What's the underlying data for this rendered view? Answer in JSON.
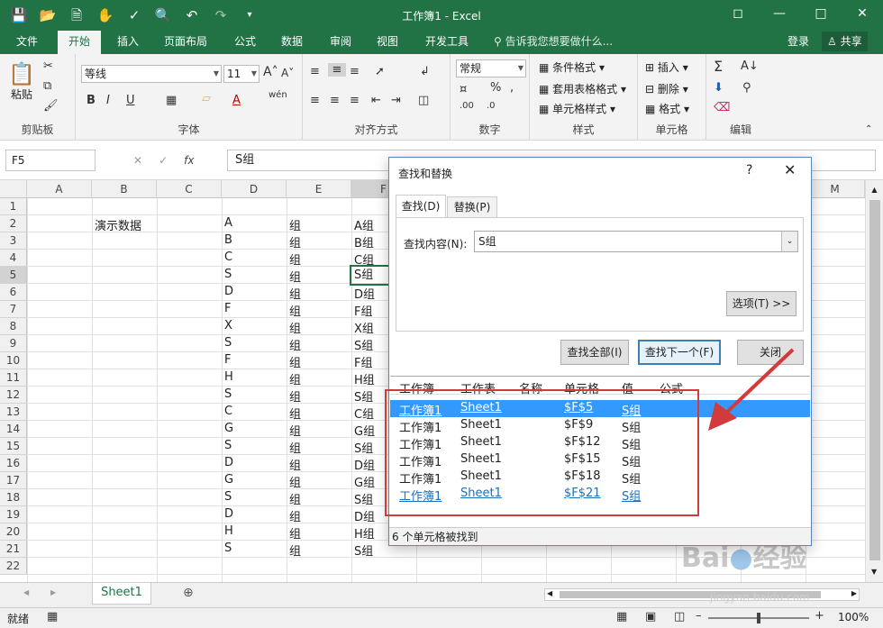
{
  "window": {
    "title": "工作簿1 - Excel"
  },
  "ribbon_tabs": [
    {
      "label": "文件"
    },
    {
      "label": "开始"
    },
    {
      "label": "插入"
    },
    {
      "label": "页面布局"
    },
    {
      "label": "公式"
    },
    {
      "label": "数据"
    },
    {
      "label": "审阅"
    },
    {
      "label": "视图"
    },
    {
      "label": "开发工具"
    }
  ],
  "tell_me": "告诉我您想要做什么...",
  "login": "登录",
  "share": "共享",
  "ribbon": {
    "clipboard": {
      "paste": "粘贴",
      "label": "剪贴板"
    },
    "font": {
      "name": "等线",
      "size": "11",
      "label": "字体",
      "bold": "B",
      "italic": "I",
      "underline": "U"
    },
    "alignment": {
      "label": "对齐方式"
    },
    "number": {
      "format": "常规",
      "label": "数字",
      "percent": "%"
    },
    "styles": {
      "conditional": "条件格式",
      "table": "套用表格格式",
      "cell": "单元格样式",
      "label": "样式"
    },
    "cells": {
      "insert": "插入",
      "delete": "删除",
      "format": "格式",
      "label": "单元格"
    },
    "editing": {
      "label": "编辑"
    }
  },
  "formula_bar": {
    "name_box": "F5",
    "fx": "fx",
    "content": "S组"
  },
  "columns": [
    "A",
    "B",
    "C",
    "D",
    "E",
    "F",
    "M"
  ],
  "rows": [
    "1",
    "2",
    "3",
    "4",
    "5",
    "6",
    "7",
    "8",
    "9",
    "10",
    "11",
    "12",
    "13",
    "14",
    "15",
    "16",
    "17",
    "18",
    "19",
    "20",
    "21",
    "22"
  ],
  "cells": {
    "B2": "演示数据",
    "D": [
      "A",
      "B",
      "C",
      "S",
      "D",
      "F",
      "X",
      "S",
      "F",
      "H",
      "S",
      "C",
      "G",
      "S",
      "D",
      "G",
      "S",
      "D",
      "H",
      "S"
    ],
    "E": "组",
    "F": [
      "A组",
      "B组",
      "C组",
      "S组",
      "D组",
      "F组",
      "X组",
      "S组",
      "F组",
      "H组",
      "S组",
      "C组",
      "G组",
      "S组",
      "D组",
      "G组",
      "S组",
      "D组",
      "H组",
      "S组"
    ]
  },
  "sheet_tab": "Sheet1",
  "status": {
    "ready": "就绪",
    "zoom": "100%"
  },
  "dialog": {
    "title": "查找和替换",
    "help": "?",
    "close": "✕",
    "tab_find": "查找(D)",
    "tab_replace": "替换(P)",
    "find_label": "查找内容(N):",
    "find_value": "S组",
    "options_button": "选项(T) >>",
    "find_all": "查找全部(I)",
    "find_next": "查找下一个(F)",
    "close_button": "关闭",
    "headers": [
      "工作簿",
      "工作表",
      "名称",
      "单元格",
      "值",
      "公式"
    ],
    "results": [
      {
        "book": "工作簿1",
        "sheet": "Sheet1",
        "cell": "$F$5",
        "value": "S组"
      },
      {
        "book": "工作簿1",
        "sheet": "Sheet1",
        "cell": "$F$9",
        "value": "S组"
      },
      {
        "book": "工作簿1",
        "sheet": "Sheet1",
        "cell": "$F$12",
        "value": "S组"
      },
      {
        "book": "工作簿1",
        "sheet": "Sheet1",
        "cell": "$F$15",
        "value": "S组"
      },
      {
        "book": "工作簿1",
        "sheet": "Sheet1",
        "cell": "$F$18",
        "value": "S组"
      },
      {
        "book": "工作簿1",
        "sheet": "Sheet1",
        "cell": "$F$21",
        "value": "S组"
      }
    ],
    "status_text": "6 个单元格被找到"
  },
  "colors": {
    "excel_green": "#217346",
    "highlight": "#d23b3b",
    "selection": "#3399ff"
  },
  "watermark": {
    "logo": "Baidu经验",
    "url": "jingyan.baidu.com"
  }
}
